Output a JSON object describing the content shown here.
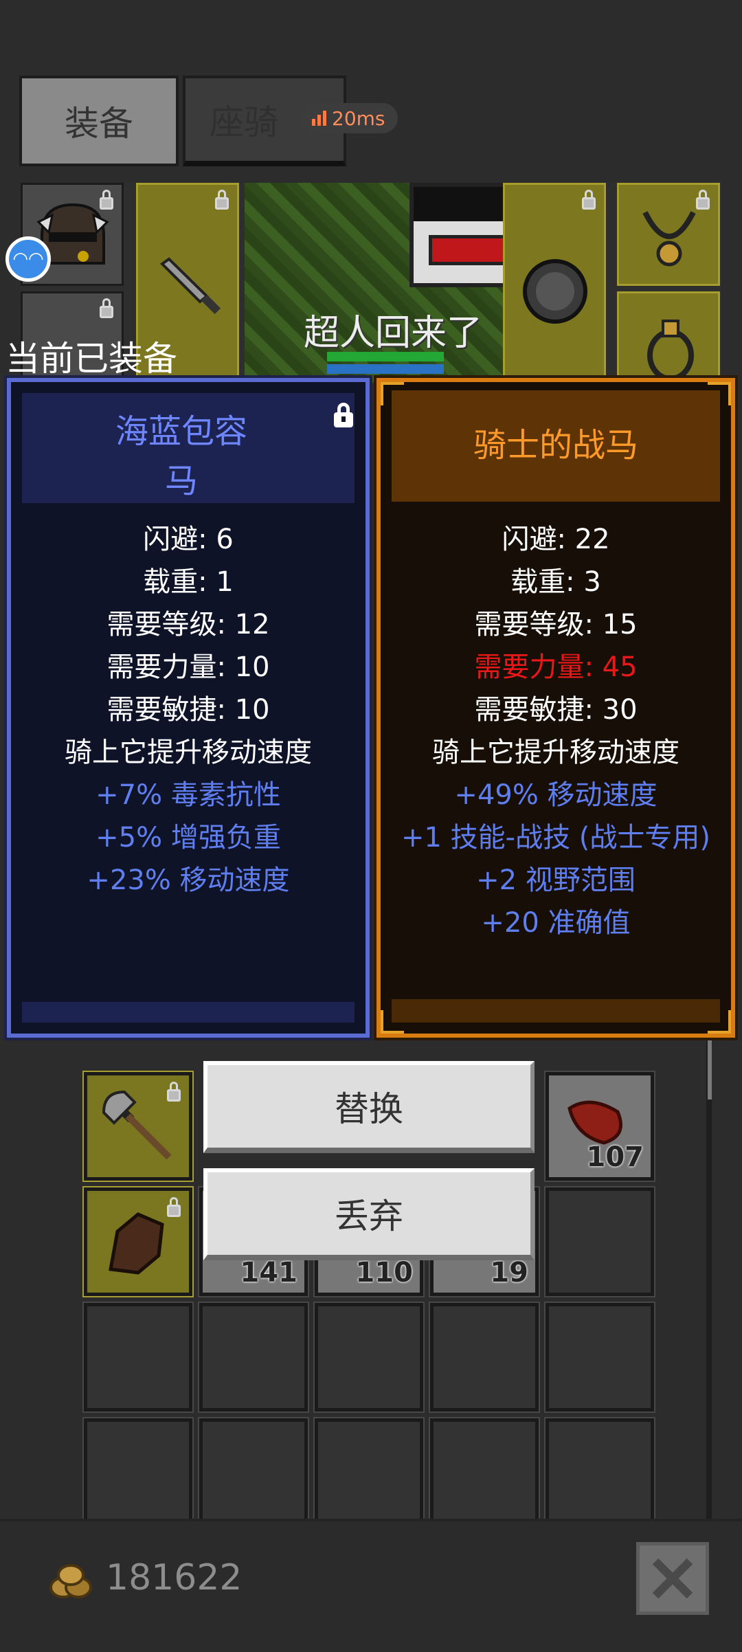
{
  "tabs": [
    {
      "label": "装备",
      "active": true
    },
    {
      "label": "座骑",
      "active": false
    }
  ],
  "ping": {
    "value": "20ms",
    "color": "#ff7a45"
  },
  "scene": {
    "hero_text": "超人回来了",
    "chat_bubble_icon": "chat-bubble-icon"
  },
  "equipped_label": "当前已装备",
  "current_item": {
    "name_line1": "海蓝包容",
    "name_line2": "马",
    "rarity_color": "#6e86ff",
    "locked": true,
    "stats": [
      {
        "text": "闪避: 6",
        "style": "normal"
      },
      {
        "text": "载重: 1",
        "style": "normal"
      },
      {
        "text": "需要等级: 12",
        "style": "normal"
      },
      {
        "text": "需要力量: 10",
        "style": "normal"
      },
      {
        "text": "需要敏捷: 10",
        "style": "normal"
      },
      {
        "text": "骑上它提升移动速度",
        "style": "normal"
      },
      {
        "text": "+7% 毒素抗性",
        "style": "blue"
      },
      {
        "text": "+5% 增强负重",
        "style": "blue"
      },
      {
        "text": "+23% 移动速度",
        "style": "blue"
      }
    ]
  },
  "compare_item": {
    "name": "骑士的战马",
    "rarity_color": "#ff9a2a",
    "stats": [
      {
        "text": "闪避: 22",
        "style": "normal"
      },
      {
        "text": "载重: 3",
        "style": "normal"
      },
      {
        "text": "需要等级: 15",
        "style": "normal"
      },
      {
        "text": "需要力量: 45",
        "style": "red"
      },
      {
        "text": "需要敏捷: 30",
        "style": "normal"
      },
      {
        "text": "骑上它提升移动速度",
        "style": "normal"
      },
      {
        "text": "+49% 移动速度",
        "style": "blue"
      },
      {
        "text": "+1 技能-战技 (战士专用)",
        "style": "blue"
      },
      {
        "text": "+2 视野范围",
        "style": "blue"
      },
      {
        "text": "+20 准确值",
        "style": "blue"
      }
    ]
  },
  "actions": {
    "replace": "替换",
    "discard": "丢弃"
  },
  "inventory": {
    "counts": [
      "107",
      "141",
      "110",
      "19"
    ]
  },
  "gold": {
    "amount": "181622",
    "icon": "gold-coins-icon"
  },
  "close_icon": "close-icon"
}
